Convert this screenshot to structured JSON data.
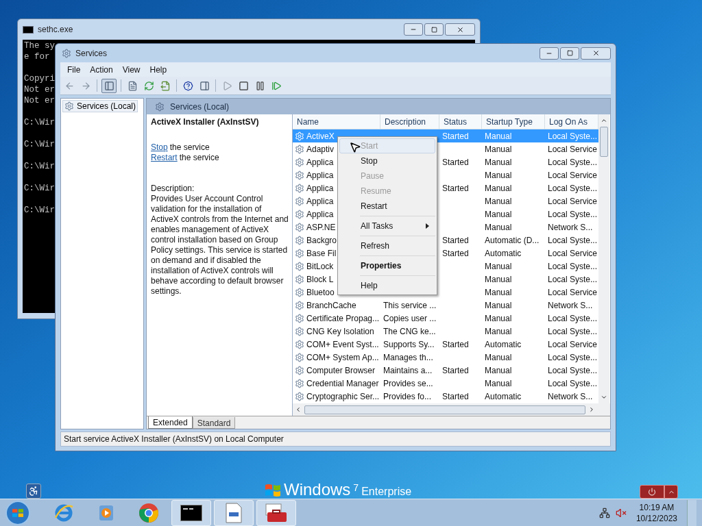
{
  "console_window": {
    "title": "sethc.exe",
    "output_blocks": [
      [
        "The sy",
        "e for"
      ],
      [
        "Copyri",
        "Not er",
        "Not er"
      ],
      [
        "C:\\Wir"
      ],
      [
        "C:\\Wir"
      ],
      [
        "C:\\Wir"
      ],
      [
        "C:\\Wir"
      ],
      [
        "C:\\Wir"
      ]
    ]
  },
  "services_window": {
    "title": "Services",
    "menu": [
      "File",
      "Action",
      "View",
      "Help"
    ],
    "tree": [
      {
        "label": "Services (Local)",
        "selected": true
      }
    ],
    "pane_title": "Services (Local)",
    "detail": {
      "heading": "ActiveX Installer (AxInstSV)",
      "actions": [
        {
          "link": "Stop",
          "text": "the service"
        },
        {
          "link": "Restart",
          "text": "the service"
        }
      ],
      "description_label": "Description:",
      "description": "Provides User Account Control validation for the installation of ActiveX controls from the Internet and enables management of ActiveX control installation based on Group Policy settings. This service is started on demand and if disabled the installation of ActiveX controls will behave according to default browser settings."
    },
    "table": {
      "columns": [
        "Name",
        "Description",
        "Status",
        "Startup Type",
        "Log On As"
      ],
      "rows": [
        {
          "name": "ActiveX",
          "status": "Started",
          "startup_type": "Manual",
          "log_on_as": "Local Syste...",
          "selected": true
        },
        {
          "name": "Adaptiv",
          "startup_type": "Manual",
          "log_on_as": "Local Service",
          "selected": false
        },
        {
          "name": "Applica",
          "status": "Started",
          "startup_type": "Manual",
          "log_on_as": "Local Syste...",
          "selected": false
        },
        {
          "name": "Applica",
          "startup_type": "Manual",
          "log_on_as": "Local Service",
          "selected": false
        },
        {
          "name": "Applica",
          "status": "Started",
          "startup_type": "Manual",
          "log_on_as": "Local Syste...",
          "selected": false
        },
        {
          "name": "Applica",
          "startup_type": "Manual",
          "log_on_as": "Local Service",
          "selected": false
        },
        {
          "name": "Applica",
          "startup_type": "Manual",
          "log_on_as": "Local Syste...",
          "selected": false
        },
        {
          "name": "ASP.NE",
          "startup_type": "Manual",
          "log_on_as": "Network S...",
          "selected": false
        },
        {
          "name": "Backgro",
          "status": "Started",
          "startup_type": "Automatic (D...",
          "log_on_as": "Local Syste...",
          "selected": false
        },
        {
          "name": "Base Fil",
          "status": "Started",
          "startup_type": "Automatic",
          "log_on_as": "Local Service",
          "selected": false
        },
        {
          "name": "BitLock",
          "startup_type": "Manual",
          "log_on_as": "Local Syste...",
          "selected": false
        },
        {
          "name": "Block L",
          "startup_type": "Manual",
          "log_on_as": "Local Syste...",
          "selected": false
        },
        {
          "name": "Bluetoo",
          "startup_type": "Manual",
          "log_on_as": "Local Service",
          "selected": false
        },
        {
          "name": "BranchCache",
          "description": "This service ...",
          "startup_type": "Manual",
          "log_on_as": "Network S...",
          "selected": false
        },
        {
          "name": "Certificate Propag...",
          "description": "Copies user ...",
          "startup_type": "Manual",
          "log_on_as": "Local Syste...",
          "selected": false
        },
        {
          "name": "CNG Key Isolation",
          "description": "The CNG ke...",
          "startup_type": "Manual",
          "log_on_as": "Local Syste...",
          "selected": false
        },
        {
          "name": "COM+ Event Syst...",
          "description": "Supports Sy...",
          "status": "Started",
          "startup_type": "Automatic",
          "log_on_as": "Local Service",
          "selected": false
        },
        {
          "name": "COM+ System Ap...",
          "description": "Manages th...",
          "startup_type": "Manual",
          "log_on_as": "Local Syste...",
          "selected": false
        },
        {
          "name": "Computer Browser",
          "description": "Maintains a...",
          "status": "Started",
          "startup_type": "Manual",
          "log_on_as": "Local Syste...",
          "selected": false
        },
        {
          "name": "Credential Manager",
          "description": "Provides se...",
          "startup_type": "Manual",
          "log_on_as": "Local Syste...",
          "selected": false
        },
        {
          "name": "Cryptographic Ser...",
          "description": "Provides fo...",
          "status": "Started",
          "startup_type": "Automatic",
          "log_on_as": "Network S...",
          "selected": false
        }
      ]
    },
    "view_tabs": [
      {
        "label": "Extended",
        "selected": true
      },
      {
        "label": "Standard",
        "selected": false
      }
    ],
    "status_bar": "Start service ActiveX Installer (AxInstSV) on Local Computer"
  },
  "context_menu": {
    "items": [
      {
        "kind": "item",
        "label": "Start",
        "disabled": true,
        "highlighted": true,
        "default": false
      },
      {
        "kind": "item",
        "label": "Stop",
        "disabled": false,
        "highlighted": false,
        "default": false
      },
      {
        "kind": "item",
        "label": "Pause",
        "disabled": true,
        "highlighted": false,
        "default": false
      },
      {
        "kind": "item",
        "label": "Resume",
        "disabled": true,
        "highlighted": false,
        "default": false
      },
      {
        "kind": "item",
        "label": "Restart",
        "disabled": false,
        "highlighted": false,
        "default": false
      },
      {
        "kind": "separator"
      },
      {
        "kind": "submenu",
        "label": "All Tasks",
        "disabled": false,
        "highlighted": false,
        "default": false
      },
      {
        "kind": "separator"
      },
      {
        "kind": "item",
        "label": "Refresh",
        "disabled": false,
        "highlighted": false,
        "default": false
      },
      {
        "kind": "separator"
      },
      {
        "kind": "item",
        "label": "Properties",
        "disabled": false,
        "highlighted": false,
        "default": true
      },
      {
        "kind": "separator"
      },
      {
        "kind": "item",
        "label": "Help",
        "disabled": false,
        "highlighted": false,
        "default": false
      }
    ]
  },
  "desktop": {
    "logo": {
      "brand": "Windows",
      "version": "7",
      "edition": "Enterprise"
    }
  },
  "taskbar": {
    "items": [
      {
        "kind": "browser-e",
        "running": false
      },
      {
        "kind": "media",
        "running": false
      },
      {
        "kind": "chrome",
        "running": false
      },
      {
        "kind": "console",
        "running": true
      },
      {
        "kind": "document",
        "running": true
      },
      {
        "kind": "toolbox",
        "running": true
      }
    ],
    "clock": {
      "time": "10:19 AM",
      "date": "10/12/2023"
    }
  }
}
